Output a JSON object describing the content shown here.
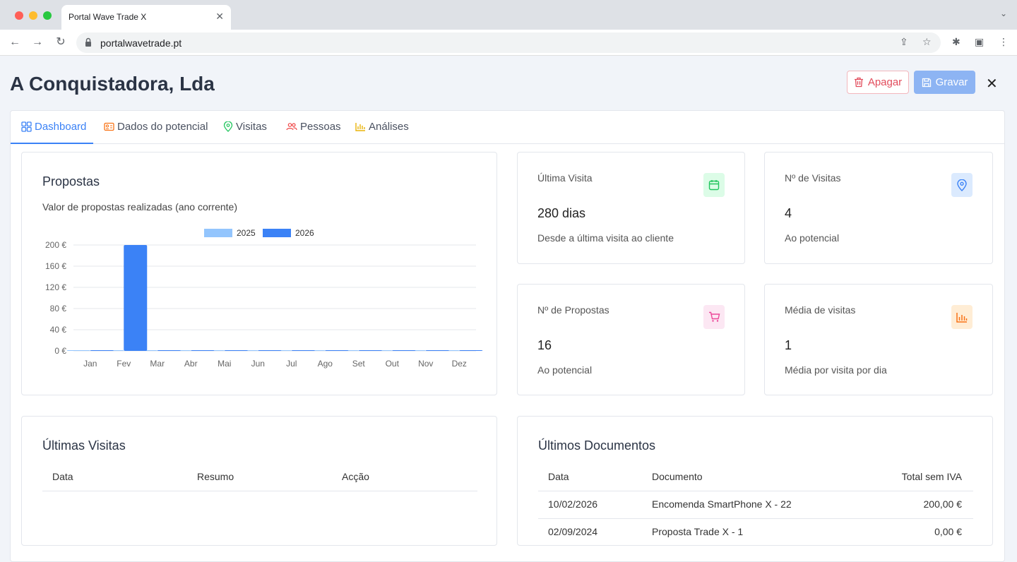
{
  "browser": {
    "tab_title": "Portal Wave Trade X",
    "url": "portalwavetrade.pt"
  },
  "page": {
    "title": "A Conquistadora, Lda",
    "delete_label": "Apagar",
    "save_label": "Gravar"
  },
  "tabs": [
    {
      "label": "Dashboard"
    },
    {
      "label": "Dados do potencial"
    },
    {
      "label": "Visitas"
    },
    {
      "label": "Pessoas"
    },
    {
      "label": "Análises"
    }
  ],
  "propostas": {
    "title": "Propostas",
    "subtitle": "Valor de propostas realizadas (ano corrente)"
  },
  "chart_data": {
    "type": "bar",
    "categories": [
      "Jan",
      "Fev",
      "Mar",
      "Abr",
      "Mai",
      "Jun",
      "Jul",
      "Ago",
      "Set",
      "Out",
      "Nov",
      "Dez"
    ],
    "series": [
      {
        "name": "2025",
        "color": "#93c5fd",
        "values": [
          0,
          0,
          0,
          0,
          0,
          0,
          0,
          0,
          0,
          0,
          0,
          0
        ]
      },
      {
        "name": "2026",
        "color": "#3b82f6",
        "values": [
          0,
          200,
          0,
          0,
          0,
          0,
          0,
          0,
          0,
          0,
          0,
          0
        ]
      }
    ],
    "y_ticks": [
      "0 €",
      "40 €",
      "80 €",
      "120 €",
      "160 €",
      "200 €"
    ],
    "ylim": [
      0,
      200
    ],
    "legend_position": "top",
    "grid": true
  },
  "stats": {
    "ultima_visita": {
      "label": "Última Visita",
      "value": "280 dias",
      "desc": "Desde a última visita ao cliente",
      "color": "#22c55e"
    },
    "n_visitas": {
      "label": "Nº de Visitas",
      "value": "4",
      "desc": "Ao potencial",
      "color": "#3b82f6"
    },
    "n_propostas": {
      "label": "Nº de Propostas",
      "value": "16",
      "desc": "Ao potencial",
      "color": "#ec4899"
    },
    "media_visitas": {
      "label": "Média de visitas",
      "value": "1",
      "desc": "Média por visita por dia",
      "color": "#f97316"
    }
  },
  "ultimas_visitas": {
    "title": "Últimas Visitas",
    "columns": [
      "Data",
      "Resumo",
      "Acção"
    ]
  },
  "ultimos_documentos": {
    "title": "Últimos Documentos",
    "columns": [
      "Data",
      "Documento",
      "Total sem IVA"
    ],
    "rows": [
      {
        "data": "10/02/2026",
        "documento": "Encomenda SmartPhone X - 22",
        "total": "200,00 €"
      },
      {
        "data": "02/09/2024",
        "documento": "Proposta Trade X - 1",
        "total": "0,00 €"
      }
    ]
  }
}
